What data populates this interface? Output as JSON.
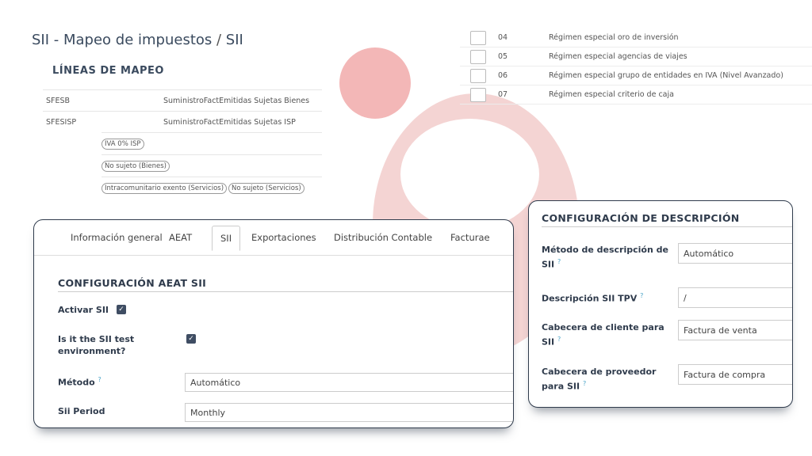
{
  "title": {
    "main": "SII - Mapeo de impuestos",
    "sep": " / ",
    "current": "SII"
  },
  "mapping": {
    "heading": "LÍNEAS DE MAPEO",
    "rows": [
      {
        "code": "SFESB",
        "desc": "SuministroFactEmitidas Sujetas Bienes"
      },
      {
        "code": "SFESISP",
        "desc": "SuministroFactEmitidas Sujetas ISP"
      }
    ],
    "tags": [
      [
        "IVA 0% ISP"
      ],
      [
        "No sujeto (Bienes)"
      ],
      [
        "Intracomunitario exento (Servicios)",
        "No sujeto (Servicios)"
      ]
    ]
  },
  "regimes": [
    {
      "num": "04",
      "label": "Régimen especial oro de inversión"
    },
    {
      "num": "05",
      "label": "Régimen especial agencias de viajes"
    },
    {
      "num": "06",
      "label": "Régimen especial grupo de entidades en IVA (Nivel Avanzado)"
    },
    {
      "num": "07",
      "label": "Régimen especial criterio de caja"
    }
  ],
  "tabs": [
    {
      "label": "Información general",
      "active": false
    },
    {
      "label": "AEAT",
      "active": false
    },
    {
      "label": "SII",
      "active": true
    },
    {
      "label": "Exportaciones",
      "active": false
    },
    {
      "label": "Distribución Contable",
      "active": false
    },
    {
      "label": "Facturae",
      "active": false
    }
  ],
  "aeat": {
    "heading": "CONFIGURACIÓN AEAT SII",
    "activar_label": "Activar SII",
    "activar_checked": true,
    "test_label": "Is it the SII test environment?",
    "test_checked": true,
    "metodo_label": "Método",
    "metodo_value": "Automático",
    "period_label": "Sii Period",
    "period_value": "Monthly",
    "help_mark": "?"
  },
  "descripcion": {
    "heading": "CONFIGURACIÓN DE DESCRIPCIÓN",
    "fields": [
      {
        "label": "Método de descripción de SII",
        "value": "Automático"
      },
      {
        "label": "Descripción SII TPV",
        "value": "/"
      },
      {
        "label": "Cabecera de cliente para SII",
        "value": "Factura de venta"
      },
      {
        "label": "Cabecera de proveedor para SII",
        "value": "Factura de compra"
      }
    ]
  },
  "colors": {
    "accent": "#2f3b4c",
    "brand_pink": "#f3b7b7",
    "help": "#4aa3c7"
  }
}
